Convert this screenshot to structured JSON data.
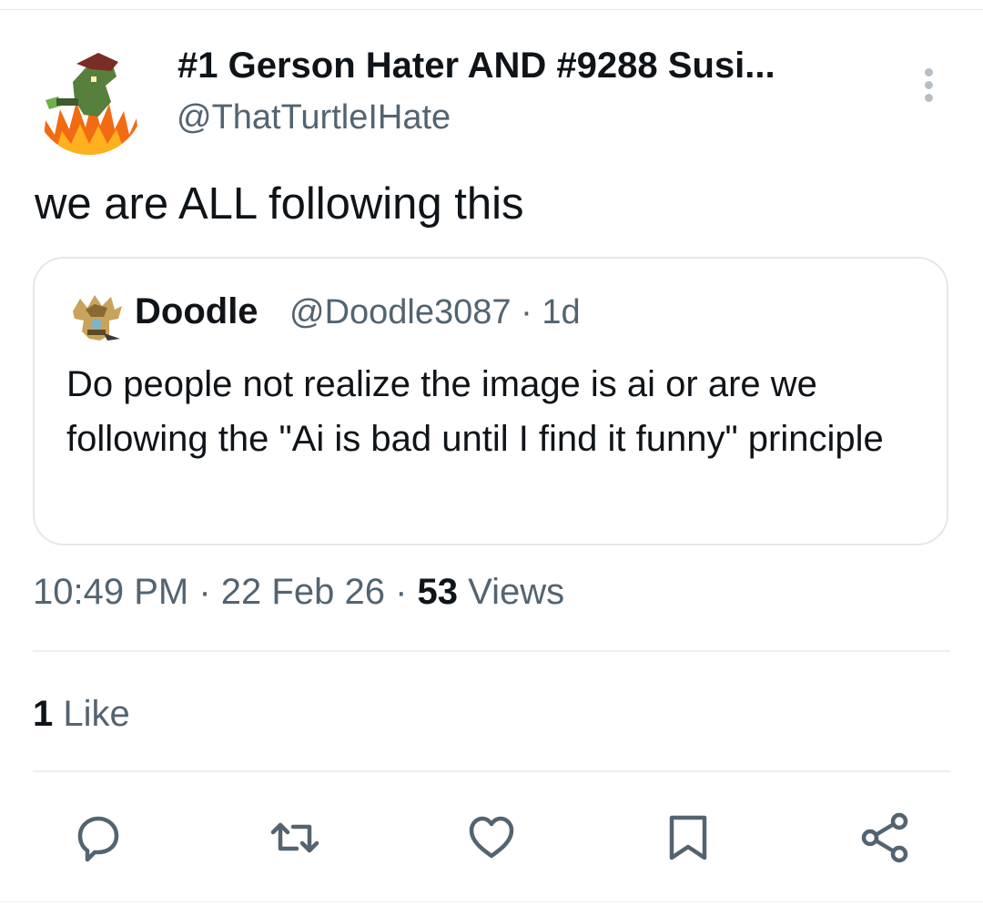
{
  "post": {
    "author_name": "#1 Gerson Hater AND #9288 Susi...",
    "author_handle": "@ThatTurtleIHate",
    "text": "we are ALL following this",
    "timestamp": "10:49 PM",
    "date": "22 Feb 26",
    "separator": "·",
    "views_count": "53",
    "views_label": "Views",
    "likes_count": "1",
    "likes_label": "Like"
  },
  "quoted": {
    "author_name": "Doodle",
    "author_handle": "@Doodle3087",
    "age": "1d",
    "separator": "·",
    "text": "Do people not realize the image is ai or are we following the \"Ai is bad until I find it funny\" principle"
  },
  "actions": [
    {
      "icon": "reply-icon"
    },
    {
      "icon": "repost-icon"
    },
    {
      "icon": "like-icon"
    },
    {
      "icon": "bookmark-icon"
    },
    {
      "icon": "share-icon"
    }
  ],
  "colors": {
    "text_primary": "#0f1419",
    "text_secondary": "#536471",
    "border": "#e4e7ea"
  }
}
